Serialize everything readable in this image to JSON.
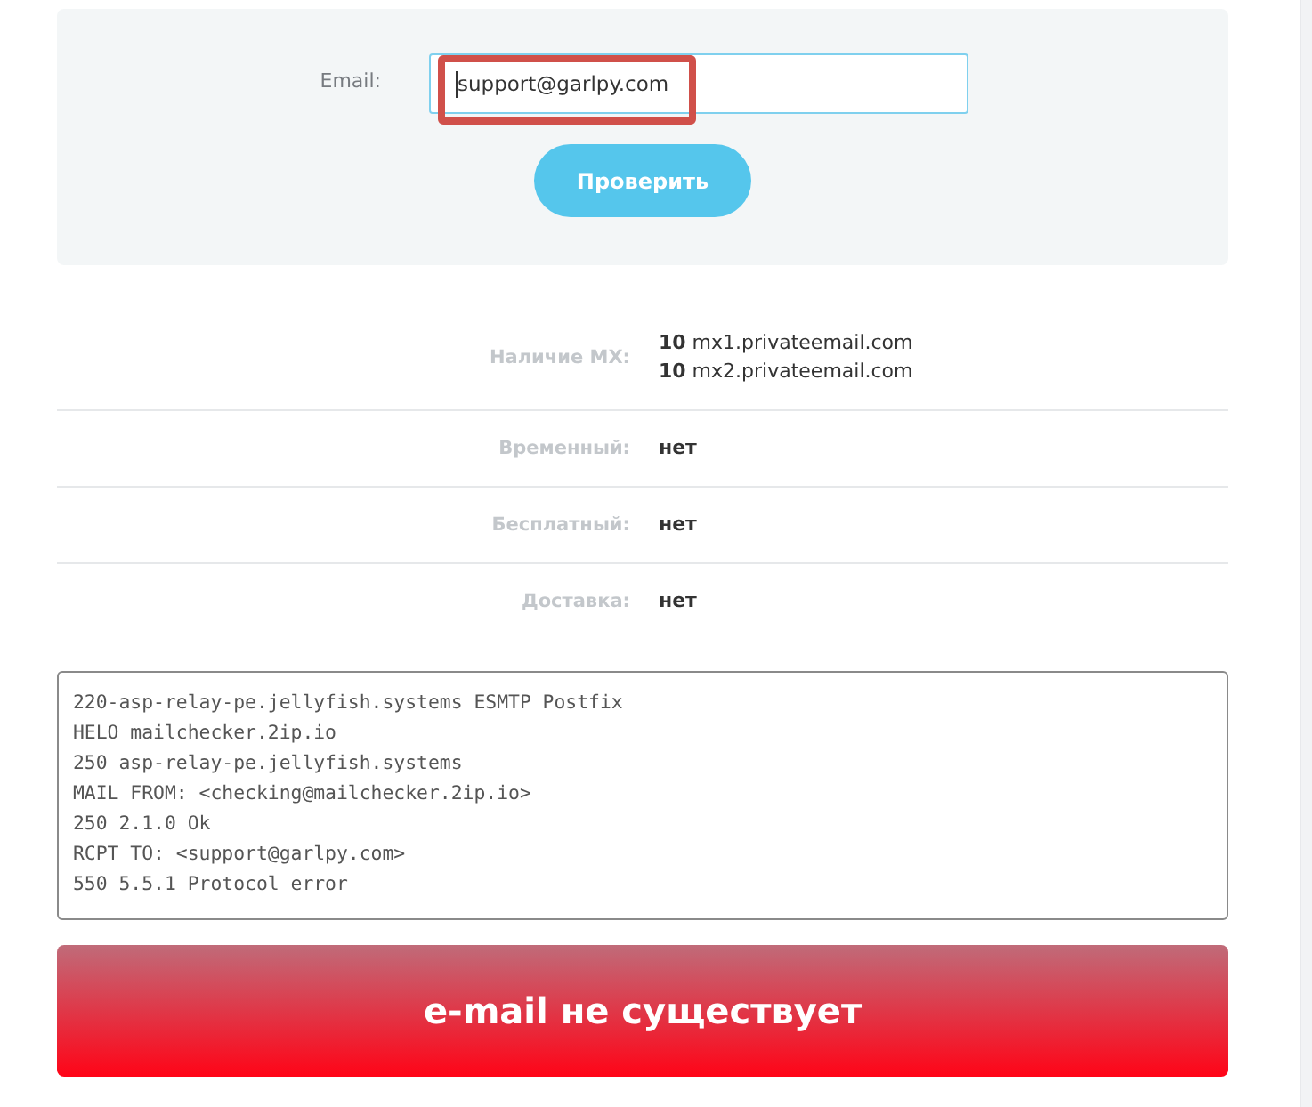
{
  "check_form": {
    "label": "Email:",
    "email_field": {
      "value": "support@garlpy.com"
    },
    "submit_button": "Проверить"
  },
  "results": [
    {
      "label": "Наличие MX:",
      "values": [
        "**10** mx1.privateemail.com",
        "**10** mx2.privateemail.com"
      ]
    },
    {
      "label": "Временный:",
      "values": [
        "нет"
      ]
    },
    {
      "label": "Бесплатный:",
      "values": [
        "нет"
      ]
    },
    {
      "label": "Доставка:",
      "values": [
        "нет"
      ]
    }
  ],
  "smtp_log": [
    "220-asp-relay-pe.jellyfish.systems ESMTP Postfix",
    "HELO mailchecker.2ip.io",
    "250 asp-relay-pe.jellyfish.systems",
    "MAIL FROM: <checking@mailchecker.2ip.io>",
    "250 2.1.0 Ok",
    "RCPT TO: <support@garlpy.com>",
    "550 5.5.1 Protocol error"
  ],
  "verdict": {
    "text": "e-mail не существует",
    "exists": false
  }
}
